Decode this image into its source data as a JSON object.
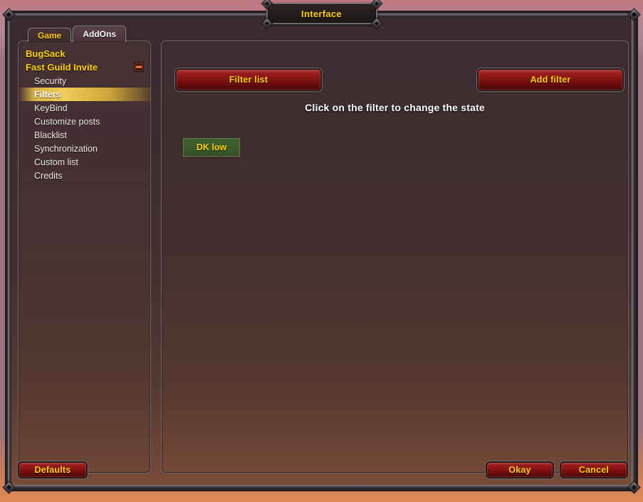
{
  "window": {
    "title": "Interface"
  },
  "tabs": [
    {
      "label": "Game",
      "active": false
    },
    {
      "label": "AddOns",
      "active": true
    }
  ],
  "sidebar": {
    "collapse_icon": "minus-icon",
    "items": [
      {
        "label": "BugSack",
        "type": "addon",
        "selected": false
      },
      {
        "label": "Fast Guild Invite",
        "type": "addon",
        "selected": false
      },
      {
        "label": "Security",
        "type": "child",
        "selected": false
      },
      {
        "label": "Filters",
        "type": "child",
        "selected": true
      },
      {
        "label": "KeyBind",
        "type": "child",
        "selected": false
      },
      {
        "label": "Customize posts",
        "type": "child",
        "selected": false
      },
      {
        "label": "Blacklist",
        "type": "child",
        "selected": false
      },
      {
        "label": "Synchronization",
        "type": "child",
        "selected": false
      },
      {
        "label": "Custom list",
        "type": "child",
        "selected": false
      },
      {
        "label": "Credits",
        "type": "child",
        "selected": false
      }
    ]
  },
  "content": {
    "filter_list_label": "Filter list",
    "add_filter_label": "Add filter",
    "hint": "Click on the filter to change the state",
    "filters": [
      {
        "label": "DK low",
        "state": "enabled"
      }
    ]
  },
  "footer": {
    "defaults_label": "Defaults",
    "okay_label": "Okay",
    "cancel_label": "Cancel"
  },
  "colors": {
    "gold_text": "#ffd100",
    "button_red": "#8b1111",
    "filter_green": "#3b5a2c",
    "highlight_gold": "#f0cd5a",
    "frame_metal": "#5c5a60"
  }
}
